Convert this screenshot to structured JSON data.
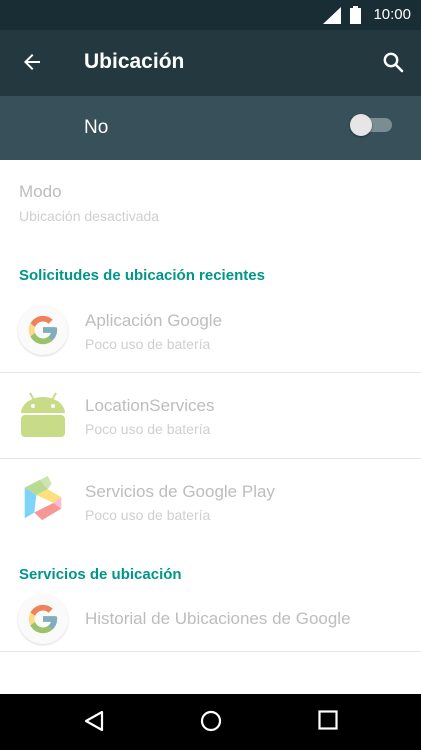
{
  "status_bar": {
    "time": "10:00"
  },
  "toolbar": {
    "title": "Ubicación"
  },
  "master_switch": {
    "label": "No",
    "state": "off"
  },
  "mode": {
    "title": "Modo",
    "subtitle": "Ubicación desactivada"
  },
  "recent_requests": {
    "header": "Solicitudes de ubicación recientes",
    "items": [
      {
        "name": "Aplicación Google",
        "detail": "Poco uso de batería",
        "icon": "google-icon"
      },
      {
        "name": "LocationServices",
        "detail": "Poco uso de batería",
        "icon": "android-icon"
      },
      {
        "name": "Servicios de Google Play",
        "detail": "Poco uso de batería",
        "icon": "google-play-services-icon"
      }
    ]
  },
  "location_services": {
    "header": "Servicios de ubicación",
    "items": [
      {
        "name": "Historial de Ubicaciones de Google",
        "icon": "google-icon"
      }
    ]
  },
  "colors": {
    "status_bar": "#192d34",
    "toolbar": "#23393f",
    "switch_bar": "#37505a",
    "accent": "#009688",
    "disabled_text": "#bdbdbd"
  }
}
